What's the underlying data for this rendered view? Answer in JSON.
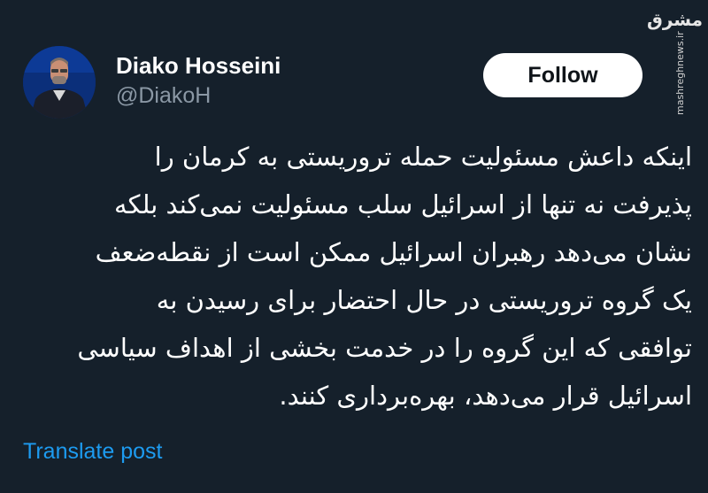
{
  "watermark": {
    "logo_text": "مشرق",
    "url": "mashreghnews.ir"
  },
  "author": {
    "display_name": "Diako Hosseini",
    "handle": "@DiakoH",
    "avatar": "profile-photo"
  },
  "follow_label": "Follow",
  "tweet": {
    "lines": [
      "اینکه داعش مسئولیت حمله تروریستی به کرمان را",
      "پذیرفت نه تنها از اسرائیل سلب مسئولیت نمی‌کند بلکه",
      "نشان می‌دهد رهبران اسرائیل ممکن است از نقطه‌ضعف",
      "یک گروه تروریستی در حال احتضار برای رسیدن به",
      "توافقی که این گروه را در خدمت بخشی از اهداف سیاسی",
      "اسرائیل قرار می‌دهد، بهره‌برداری کنند."
    ]
  },
  "translate_label": "Translate post",
  "colors": {
    "background": "#15202b",
    "text": "#ffffff",
    "secondary_text": "#8b98a5",
    "link": "#1d9bf0",
    "button_bg": "#ffffff",
    "button_text": "#0f1419"
  }
}
